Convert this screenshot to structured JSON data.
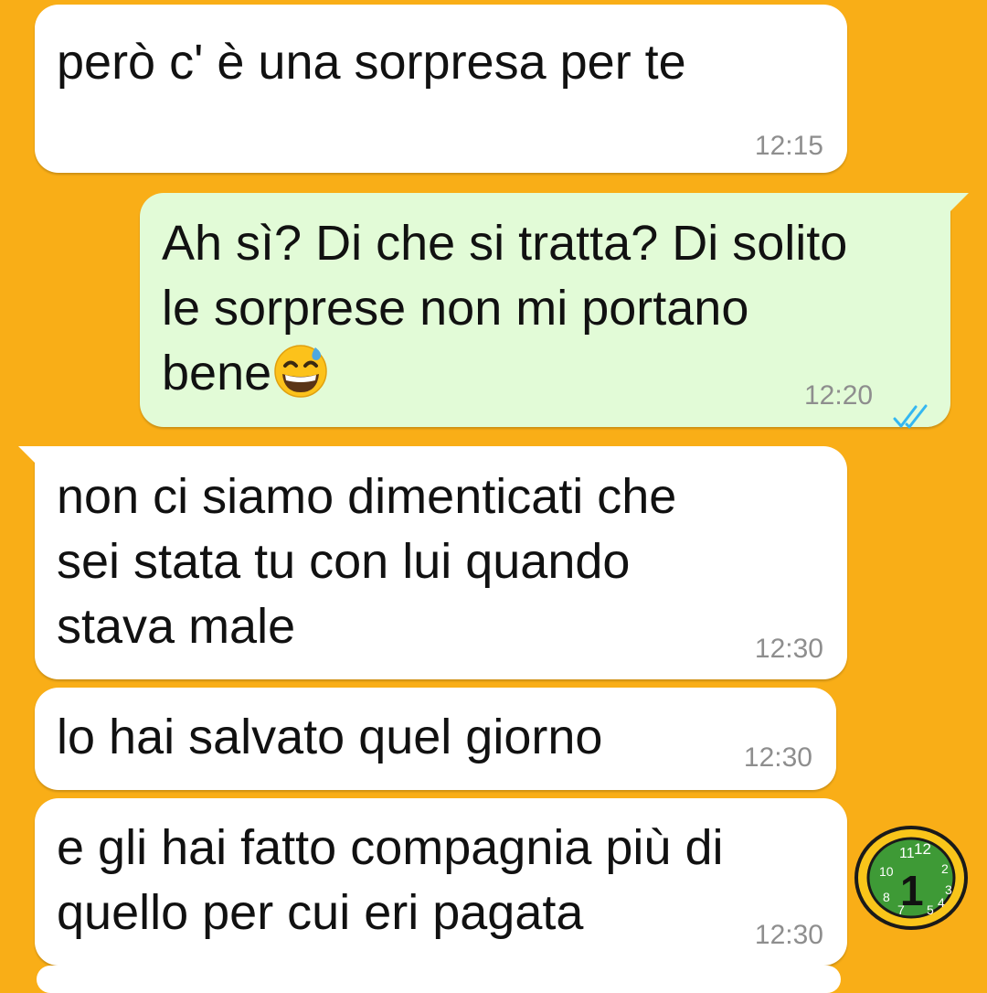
{
  "chat": {
    "background_color": "#F9AE17",
    "incoming_bubble_color": "#FFFFFF",
    "outgoing_bubble_color": "#E2FBD7",
    "read_tick_color": "#34B7F1",
    "messages": [
      {
        "direction": "incoming",
        "text": "però c' è una sorpresa per te",
        "time": "12:15"
      },
      {
        "direction": "outgoing",
        "text": "Ah sì? Di che si tratta? Di solito\nle sorprese non mi portano\nbene",
        "emoji": "grinning-sweat-emoji",
        "time": "12:20",
        "status": "read-double-tick-icon"
      },
      {
        "direction": "incoming",
        "text": "non ci siamo dimenticati che\nsei stata tu con lui quando\nstava male",
        "time": "12:30"
      },
      {
        "direction": "incoming",
        "text": "lo hai salvato quel giorno",
        "time": "12:30"
      },
      {
        "direction": "incoming",
        "text": "e gli hai fatto compagnia più di\nquello per cui eri pagata",
        "time": "12:30"
      }
    ],
    "sticker": {
      "icon": "clock-sticker-icon",
      "label": "1"
    }
  }
}
